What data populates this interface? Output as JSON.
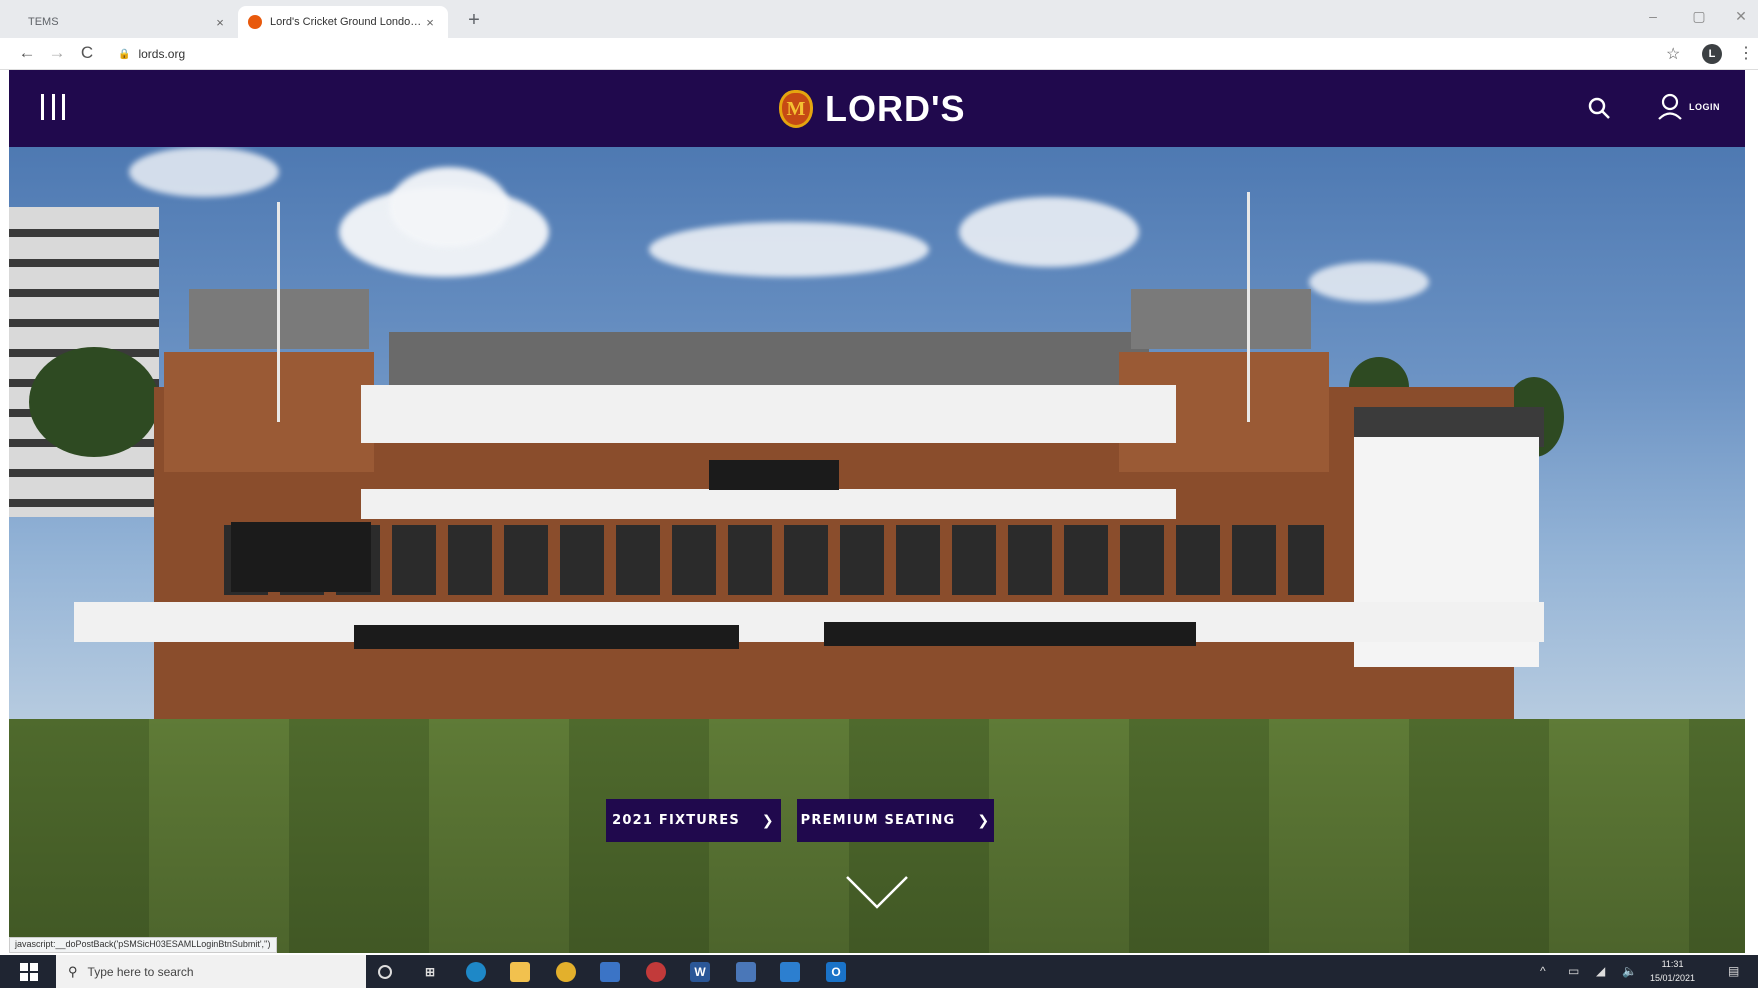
{
  "browser": {
    "tabs": [
      {
        "title": "TEMS",
        "active": false
      },
      {
        "title": "Lord's Cricket Ground London | ",
        "active": true
      }
    ],
    "new_tab_symbol": "+",
    "close_symbol": "×",
    "window_controls": {
      "minimize": "–",
      "maximize": "▢",
      "close": "✕"
    },
    "nav": {
      "back": "←",
      "forward": "→",
      "reload": "C"
    },
    "url": "lords.org",
    "profile_initial": "L"
  },
  "site": {
    "logo_mark": "M",
    "logo_text": "LORD'S",
    "login_label": "LOGIN",
    "colors": {
      "brand": "#20094d",
      "logo_accent": "#c64a14"
    }
  },
  "hero": {
    "cta_buttons": [
      {
        "label": "2021 FIXTURES",
        "icon": "chevron-right-icon"
      },
      {
        "label": "PREMIUM SEATING",
        "icon": "chevron-right-icon"
      }
    ]
  },
  "status_bar_url": "javascript:__doPostBack('pSMSicH03ESAMLLoginBtnSubmit','')",
  "taskbar": {
    "search_placeholder": "Type here to search",
    "time": "11:31",
    "date": "15/01/2021"
  }
}
